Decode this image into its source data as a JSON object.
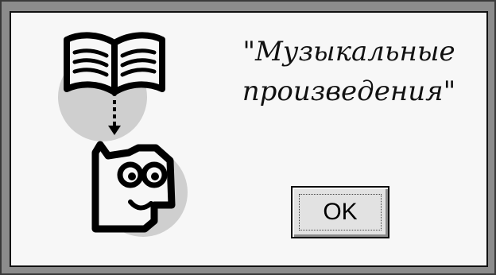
{
  "dialog": {
    "title_line1": "\"Музыкальные",
    "title_line2": "произведения\"",
    "ok_label": "OK"
  },
  "icons": {
    "book": "open-book-icon",
    "arrow": "dashed-down-arrow-icon",
    "face": "reading-face-icon"
  },
  "colors": {
    "window_frame": "#8c8c8c",
    "dialog_background": "#f7f7f7",
    "illustration_circles": "#cfcfcf",
    "button_face": "#e2e2e2"
  }
}
